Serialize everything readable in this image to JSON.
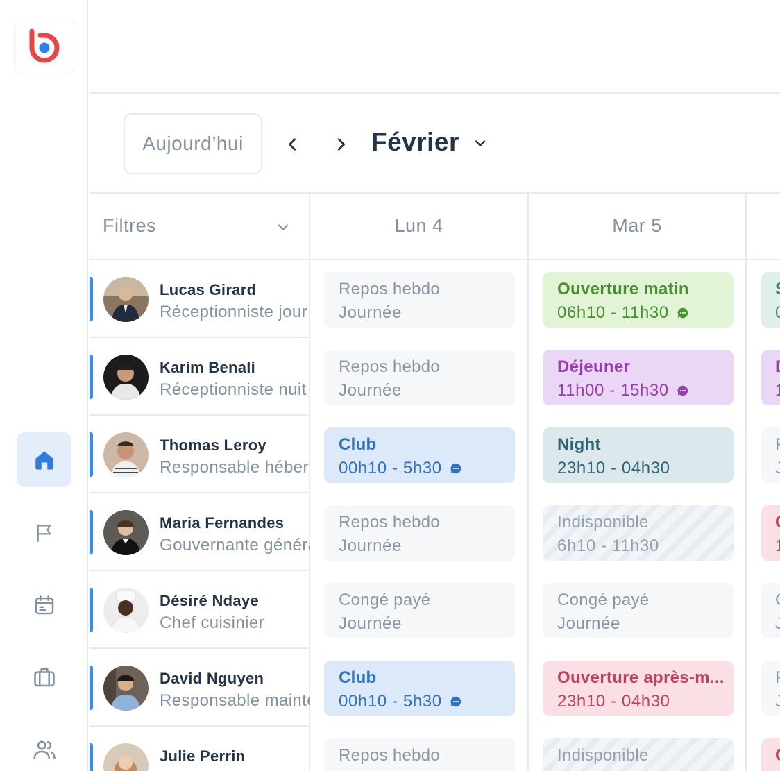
{
  "header": {
    "today_label": "Aujourd’hui",
    "month_label": "Février"
  },
  "grid": {
    "filters_label": "Filtres",
    "days": [
      "Lun 4",
      "Mar 5"
    ]
  },
  "employees": [
    {
      "name": "Lucas Girard",
      "role": "Réceptionniste jour"
    },
    {
      "name": "Karim Benali",
      "role": "Réceptionniste nuit"
    },
    {
      "name": "Thomas Leroy",
      "role": "Responsable hébergement"
    },
    {
      "name": "Maria Fernandes",
      "role": "Gouvernante générale"
    },
    {
      "name": "Désiré Ndaye",
      "role": "Chef cuisinier"
    },
    {
      "name": "David Nguyen",
      "role": "Responsable maintenance"
    },
    {
      "name": "Julie Perrin",
      "role": ""
    }
  ],
  "shifts": {
    "mon": [
      {
        "title": "Repos hebdo",
        "sub": "Journée",
        "style": "neutral",
        "message": false
      },
      {
        "title": "Repos hebdo",
        "sub": "Journée",
        "style": "neutral",
        "message": false
      },
      {
        "title": "Club",
        "sub": "00h10 - 5h30",
        "style": "blue",
        "message": true
      },
      {
        "title": "Repos hebdo",
        "sub": "Journée",
        "style": "neutral",
        "message": false
      },
      {
        "title": "Congé payé",
        "sub": "Journée",
        "style": "neutral",
        "message": false
      },
      {
        "title": "Club",
        "sub": "00h10 - 5h30",
        "style": "blue",
        "message": true
      },
      {
        "title": "Repos hebdo",
        "sub": "",
        "style": "neutral",
        "message": false
      }
    ],
    "tue": [
      {
        "title": "Ouverture matin",
        "sub": "06h10 - 11h30",
        "style": "green",
        "message": true
      },
      {
        "title": "Déjeuner",
        "sub": "11h00 - 15h30",
        "style": "purple",
        "message": true
      },
      {
        "title": "Night",
        "sub": "23h10 - 04h30",
        "style": "teal",
        "message": false
      },
      {
        "title": "Indisponible",
        "sub": "6h10 - 11h30",
        "style": "stripe",
        "message": false
      },
      {
        "title": "Congé payé",
        "sub": "Journée",
        "style": "neutral",
        "message": false
      },
      {
        "title": "Ouverture après-m...",
        "sub": "23h10 - 04h30",
        "style": "red",
        "message": false
      },
      {
        "title": "Indisponible",
        "sub": "",
        "style": "stripe",
        "message": false
      }
    ],
    "wed_partial": [
      {
        "title": "S",
        "sub": "0",
        "style": "mint"
      },
      {
        "title": "D",
        "sub": "1",
        "style": "purple"
      },
      {
        "title": "F",
        "sub": "J",
        "style": "neutral"
      },
      {
        "title": "C",
        "sub": "1",
        "style": "red"
      },
      {
        "title": "C",
        "sub": "J",
        "style": "neutral"
      },
      {
        "title": "F",
        "sub": "J",
        "style": "neutral"
      },
      {
        "title": "C",
        "sub": "",
        "style": "red"
      }
    ]
  },
  "colors": {
    "accent": "#3b8cf0",
    "logo_red": "#ea4444",
    "logo_blue": "#2f80ed"
  }
}
